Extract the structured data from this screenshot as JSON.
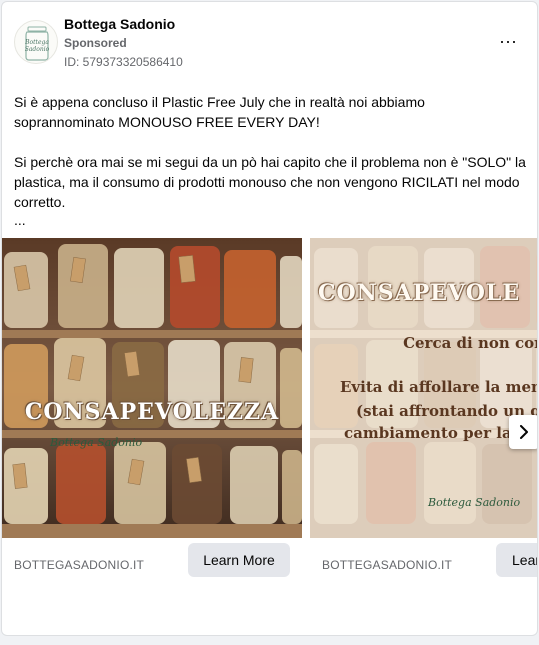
{
  "post": {
    "page_name": "Bottega Sadonio",
    "sponsored": "Sponsored",
    "ad_id": "ID: 579373320586410",
    "more_menu": "···",
    "avatar_text_line1": "Bottega",
    "avatar_text_line2": "Sadonio",
    "paragraph1": "Si è appena concluso il Plastic Free July che in realtà noi abbiamo soprannominato MONOUSO FREE EVERY DAY!",
    "paragraph2": "Si perchè ora mai se mi segui da un pò hai capito che il problema non è \"SOLO\" la plastica, ma il consumo di prodotti monouso che non vengono RICILATI nel modo corretto.",
    "see_more": "..."
  },
  "carousel": {
    "cards": [
      {
        "overlay_word": "CONSAPEVOLEZZA",
        "brand_script": "Bottega Sadonio",
        "domain": "BOTTEGASADONIO.IT",
        "cta": "Learn More"
      },
      {
        "overlay_word": "CONSAPEVOLE",
        "line1": "Cerca di non correre",
        "line2": "Evita di affollare la men",
        "line3": "(stai affrontando un gran",
        "line4": "cambiamento per la tu",
        "brand_script": "Bottega Sadonio",
        "domain": "BOTTEGASADONIO.IT",
        "cta": "Lear"
      }
    ],
    "next_icon": "chevron-right-icon"
  },
  "colors": {
    "text_primary": "#050505",
    "text_secondary": "#65676b",
    "button_bg": "#e4e6eb",
    "background": "#f0f2f5"
  }
}
